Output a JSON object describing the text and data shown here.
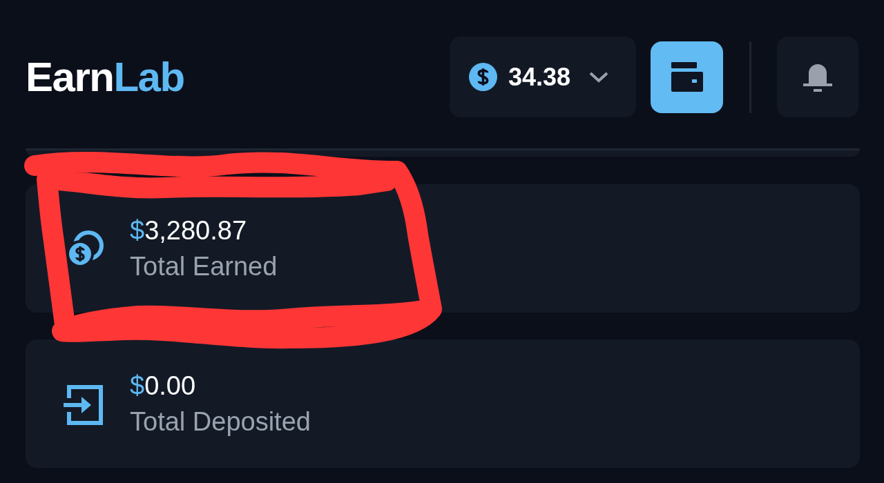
{
  "logo": {
    "parts": [
      {
        "text": "Earn",
        "kind": "plain"
      },
      {
        "text": "Lab",
        "kind": "accent"
      }
    ]
  },
  "balance": {
    "amount": "34.38"
  },
  "stats": [
    {
      "currency": "$",
      "amount": "3,280.87",
      "label": "Total Earned",
      "kind": "coins"
    },
    {
      "currency": "$",
      "amount": "0.00",
      "label": "Total Deposited",
      "kind": "deposit"
    }
  ],
  "annotations": [
    {
      "kind": "scribble"
    }
  ]
}
